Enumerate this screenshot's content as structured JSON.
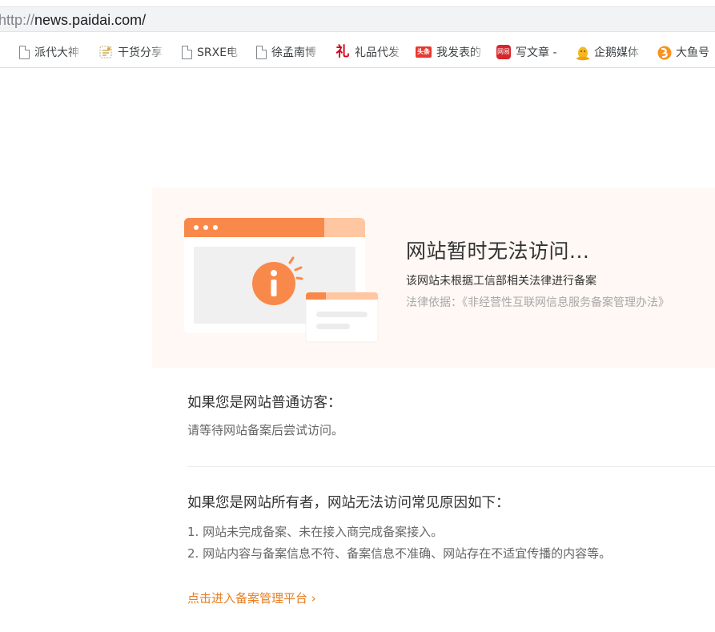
{
  "browser": {
    "url_scheme": "http://",
    "url_host": "news.paidai.com/",
    "bookmarks": [
      {
        "label": "派代大神",
        "icon": "page-icon"
      },
      {
        "label": "干货分享",
        "icon": "document-icon"
      },
      {
        "label": "SRXE电",
        "icon": "page-icon"
      },
      {
        "label": "徐孟南博",
        "icon": "page-icon"
      },
      {
        "label": "礼品代发",
        "icon": "li-gift-icon"
      },
      {
        "label": "我发表的",
        "icon": "toutiao-icon",
        "icon_text": "头条"
      },
      {
        "label": "写文章 -",
        "icon": "write-article-icon",
        "icon_text": "网易"
      },
      {
        "label": "企鹅媒体",
        "icon": "penguin-icon"
      },
      {
        "label": "大鱼号",
        "icon": "dayu-icon"
      }
    ]
  },
  "notice": {
    "title": "网站暂时无法访问...",
    "description": "该网站未根据工信部相关法律进行备案",
    "law_basis": "法律依据：《非经营性互联网信息服务备案管理办法》"
  },
  "visitor": {
    "title": "如果您是网站普通访客：",
    "text": "请等待网站备案后尝试访问。"
  },
  "owner": {
    "title": "如果您是网站所有者，网站无法访问常见原因如下：",
    "reasons": [
      "1. 网站未完成备案、未在接入商完成备案接入。",
      "2. 网站内容与备案信息不符、备案信息不准确、网站存在不适宜传播的内容等。"
    ]
  },
  "link": {
    "label": "点击进入备案管理平台 ›"
  },
  "colors": {
    "accent": "#e67e22",
    "banner_bg": "#fff8f4",
    "illus_orange": "#f9894a"
  }
}
